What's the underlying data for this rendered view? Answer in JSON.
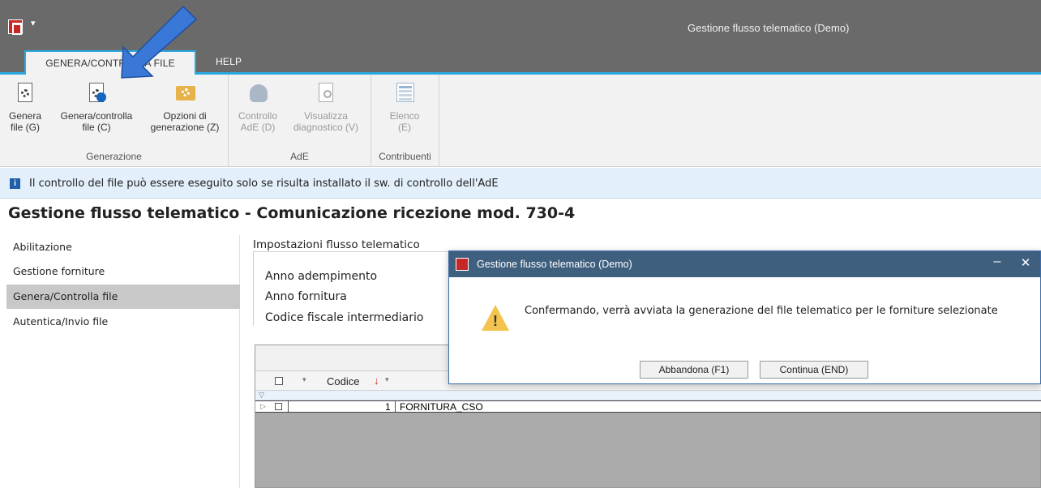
{
  "window": {
    "title": "Gestione flusso telematico  (Demo)",
    "quick_access_glyph": "▾"
  },
  "tabs": [
    {
      "label": "GENERA/CONTROLLA FILE",
      "active": true
    },
    {
      "label": "HELP",
      "active": false
    }
  ],
  "ribbon": {
    "groups": [
      {
        "label": "Generazione",
        "buttons": [
          {
            "line1": "Genera",
            "line2": "file (G)",
            "icon": "file-gear-icon",
            "enabled": true
          },
          {
            "line1": "Genera/controlla",
            "line2": "file (C)",
            "icon": "file-check-gear-icon",
            "enabled": true
          },
          {
            "line1": "Opzioni di",
            "line2": "generazione (Z)",
            "icon": "folder-gear-icon",
            "enabled": true
          }
        ]
      },
      {
        "label": "AdE",
        "buttons": [
          {
            "line1": "Controllo",
            "line2": "AdE (D)",
            "icon": "flask-icon",
            "enabled": false
          },
          {
            "line1": "Visualizza",
            "line2": "diagnostico (V)",
            "icon": "document-search-icon",
            "enabled": false
          }
        ]
      },
      {
        "label": "Contribuenti",
        "buttons": [
          {
            "line1": "Elenco",
            "line2": "(E)",
            "icon": "list-icon",
            "enabled": false
          }
        ]
      }
    ]
  },
  "info_bar": {
    "icon": "i",
    "text": "Il controllo del file può essere eseguito solo se risulta installato il sw. di controllo dell'AdE"
  },
  "page_title": "Gestione flusso telematico - Comunicazione ricezione mod. 730-4",
  "nav": [
    {
      "label": "Abilitazione",
      "active": false
    },
    {
      "label": "Gestione forniture",
      "active": false
    },
    {
      "label": "Genera/Controlla file",
      "active": true
    },
    {
      "label": "Autentica/Invio file",
      "active": false
    }
  ],
  "settings": {
    "title": "Impostazioni flusso telematico",
    "fields": [
      "Anno adempimento",
      "Anno fornitura",
      "Codice fiscale intermediario"
    ]
  },
  "grid": {
    "columns": [
      {
        "label": "Codice",
        "sorted": "desc"
      }
    ],
    "rows": [
      {
        "code": "1",
        "name": "FORNITURA_CSO",
        "checked": false
      }
    ]
  },
  "dialog": {
    "title": "Gestione flusso telematico  (Demo)",
    "message": "Confermando, verrà avviata la generazione del file telematico per le forniture selezionate",
    "buttons": {
      "cancel": "Abbandona (F1)",
      "continue": "Continua (END)"
    },
    "minimize_glyph": "–",
    "close_glyph": "✕",
    "warning_glyph": "!"
  },
  "colors": {
    "title_bar": "#6a6a6a",
    "tab_accent": "#29a8e0",
    "dialog_title": "#3f5f7f",
    "info_bar": "#e3effb",
    "annotation_arrow": "#3a78d8"
  }
}
